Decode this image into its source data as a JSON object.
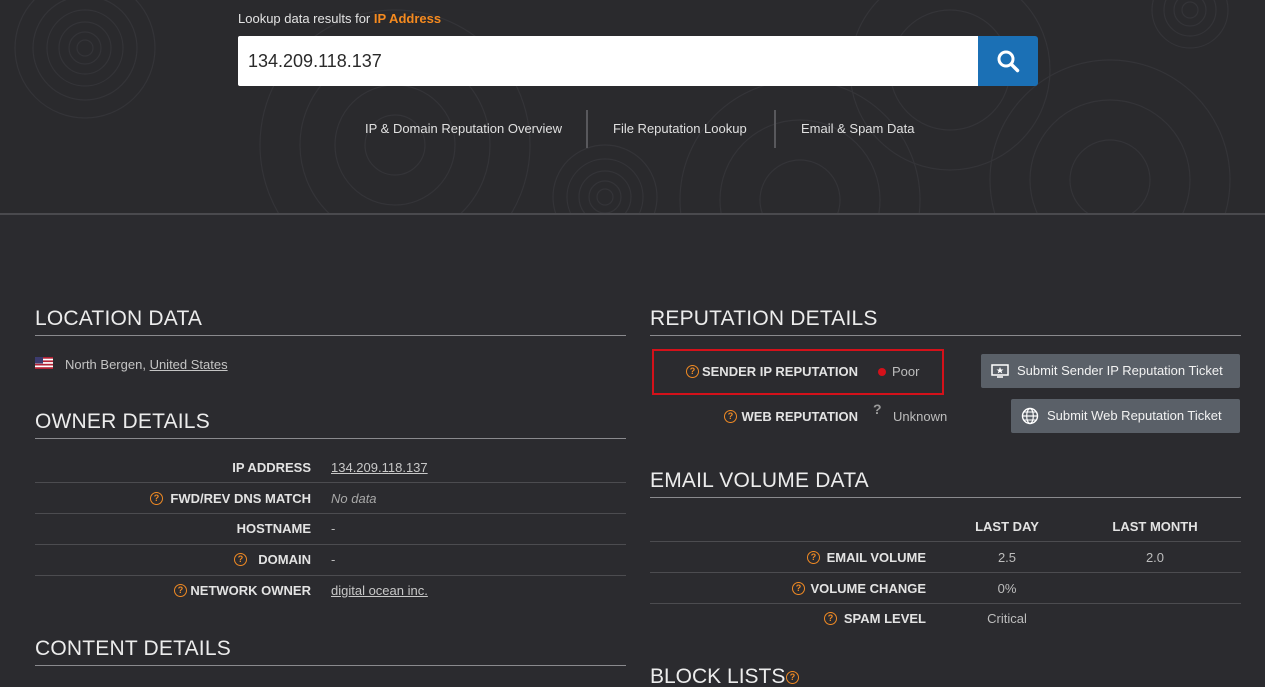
{
  "hero": {
    "label_prefix": "Lookup data results for",
    "label_accent": "IP Address",
    "search_value": "134.209.118.137",
    "search_icon": "search-icon"
  },
  "nav": {
    "items": [
      "IP & Domain Reputation Overview",
      "File Reputation Lookup",
      "Email & Spam Data"
    ]
  },
  "location": {
    "title": "LOCATION DATA",
    "flag_icon": "us-flag-icon",
    "city": "North Bergen,",
    "country": "United States"
  },
  "owner": {
    "title": "OWNER DETAILS",
    "rows": [
      {
        "label": "IP ADDRESS",
        "value": "134.209.118.137"
      },
      {
        "label": "FWD/REV DNS MATCH",
        "value": "No data"
      },
      {
        "label": "HOSTNAME",
        "value": "-"
      },
      {
        "label": "DOMAIN",
        "value": "-"
      },
      {
        "label": "NETWORK OWNER",
        "value": "digital ocean inc."
      }
    ]
  },
  "content": {
    "title": "CONTENT DETAILS"
  },
  "reputation": {
    "title": "REPUTATION DETAILS",
    "sender_label": "SENDER IP REPUTATION",
    "sender_value": "Poor",
    "sender_status_color": "#d4111a",
    "web_label": "WEB REPUTATION",
    "web_value": "Unknown",
    "web_unknown_glyph": "?",
    "submit_sender": "Submit Sender IP Reputation Ticket",
    "submit_web": "Submit Web Reputation Ticket"
  },
  "email_volume": {
    "title": "EMAIL VOLUME DATA",
    "columns": [
      "LAST DAY",
      "LAST MONTH"
    ],
    "rows": [
      {
        "label": "EMAIL VOLUME",
        "last_day": "2.5",
        "last_month": "2.0"
      },
      {
        "label": "VOLUME CHANGE",
        "last_day": "0%",
        "last_month": ""
      },
      {
        "label": "SPAM LEVEL",
        "last_day": "Critical",
        "last_month": ""
      }
    ]
  },
  "block_lists": {
    "title": "BLOCK LISTS"
  },
  "colors": {
    "accent": "#f58a1f",
    "search_button": "#1b70b5",
    "background": "#2b2b2f",
    "highlight": "#d4111a"
  },
  "help_glyph": "?"
}
